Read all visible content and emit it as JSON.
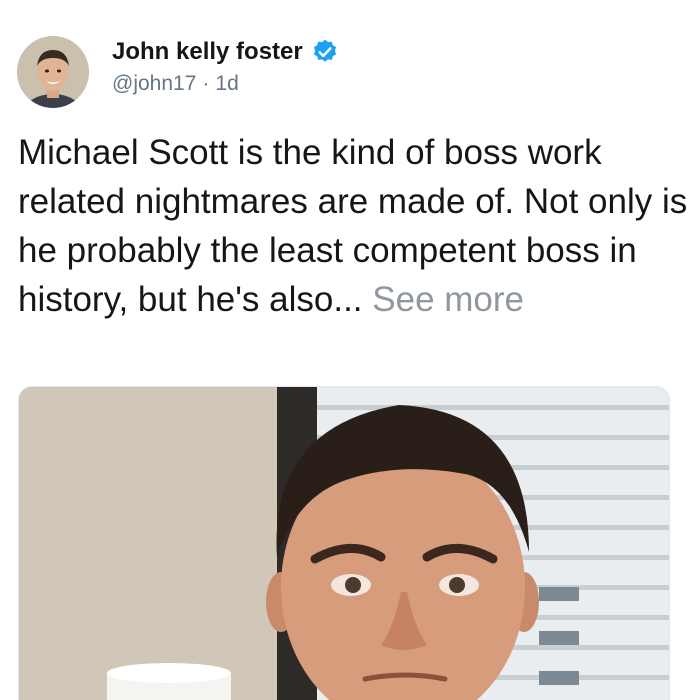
{
  "tweet": {
    "author_name": "John kelly foster",
    "handle": "@john17",
    "separator": "·",
    "time": "1d",
    "text": "Michael Scott is the kind of boss work related nightmares are made of. Not only is he probably the least competent boss in history, but he's also...",
    "see_more": "See more"
  },
  "colors": {
    "verified": "#1da1f2",
    "handle": "#657786",
    "see_more": "#8f98a1"
  },
  "icons": {
    "verified": "verified-badge-icon"
  }
}
